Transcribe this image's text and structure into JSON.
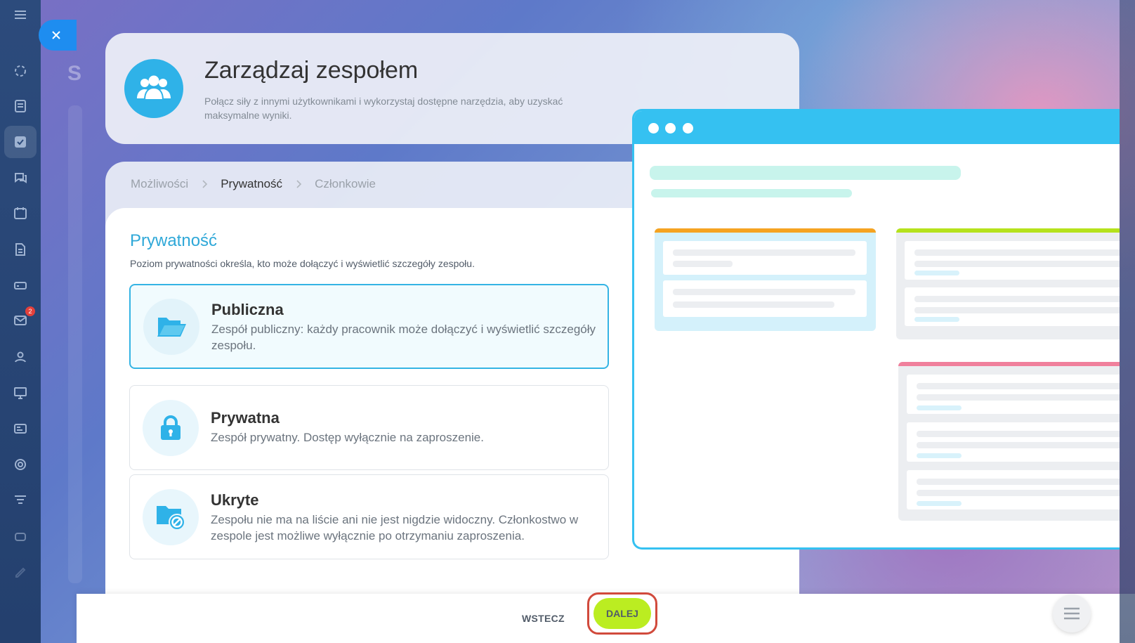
{
  "header": {
    "title": "Zarządzaj zespołem",
    "description": "Połącz siły z innymi użytkownikami i wykorzystaj dostępne narzędzia, aby uzyskać maksymalne wyniki."
  },
  "breadcrumbs": [
    "Możliwości",
    "Prywatność",
    "Członkowie"
  ],
  "section": {
    "title": "Prywatność",
    "description": "Poziom prywatności określa, kto może dołączyć i wyświetlić szczegóły zespołu."
  },
  "options": [
    {
      "title": "Publiczna",
      "description": "Zespół publiczny: każdy pracownik może dołączyć i wyświetlić szczegóły zespołu.",
      "icon": "folder-open-icon",
      "selected": true
    },
    {
      "title": "Prywatna",
      "description": "Zespół prywatny. Dostęp wyłącznie na zaproszenie.",
      "icon": "lock-icon",
      "selected": false
    },
    {
      "title": "Ukryte",
      "description": "Zespołu nie ma na liście ani nie jest nigdzie widoczny. Członkostwo w zespole jest możliwe wyłącznie po otrzymaniu zaproszenia.",
      "icon": "folder-blocked-icon",
      "selected": false
    }
  ],
  "footer": {
    "back_label": "WSTECZ",
    "next_label": "DALEJ"
  },
  "sidebar": {
    "mail_badge": "2"
  },
  "colors": {
    "accent": "#35c1f1",
    "next_button": "#bbed21",
    "highlight_outline": "#d14a3c"
  }
}
